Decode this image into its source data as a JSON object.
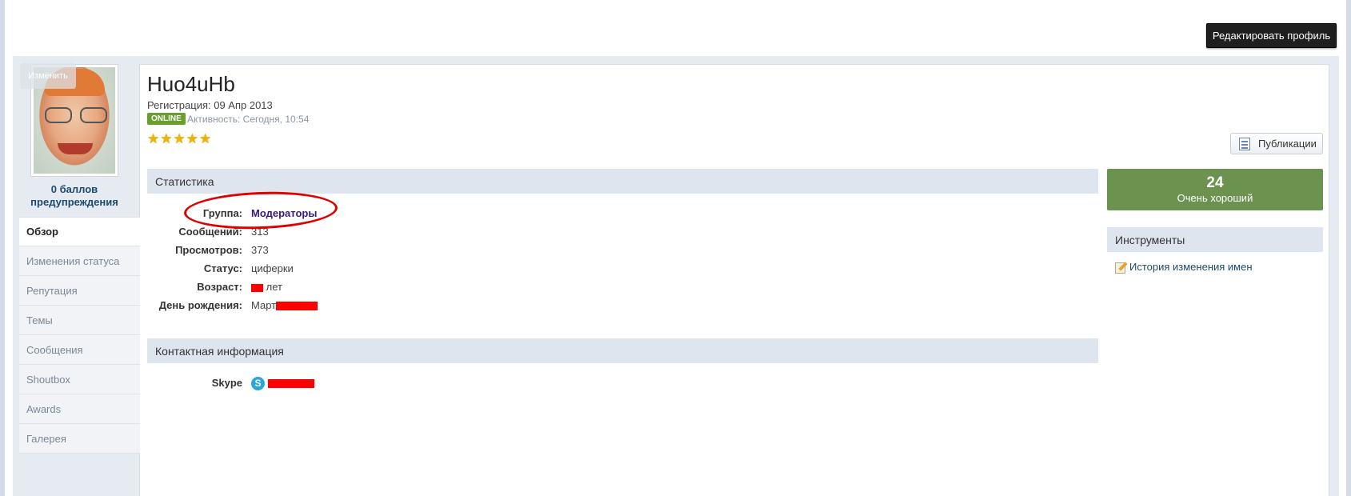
{
  "header": {
    "edit_profile_label": "Редактировать профиль"
  },
  "sidebar": {
    "change_avatar_label": "Изменить",
    "warn_points": "0 баллов предупреждения",
    "items": [
      {
        "label": "Обзор",
        "active": true
      },
      {
        "label": "Изменения статуса"
      },
      {
        "label": "Репутация"
      },
      {
        "label": "Темы"
      },
      {
        "label": "Сообщения"
      },
      {
        "label": "Shoutbox"
      },
      {
        "label": "Awards"
      },
      {
        "label": "Галерея"
      }
    ]
  },
  "profile": {
    "username": "Huo4uHb",
    "registration": "Регистрация: 09 Апр 2013",
    "online_badge": "ONLINE",
    "activity": "Активность: Сегодня, 10:54",
    "rating_stars": 5,
    "publications_label": "Публикации"
  },
  "stats": {
    "title": "Статистика",
    "fields": [
      {
        "label": "Группа:",
        "value": "Модераторы"
      },
      {
        "label": "Сообщений:",
        "value": "313"
      },
      {
        "label": "Просмотров:",
        "value": "373"
      },
      {
        "label": "Статус:",
        "value": "циферки"
      },
      {
        "label": "Возраст:",
        "value": "лет"
      },
      {
        "label": "День рождения:",
        "value": "Март"
      }
    ]
  },
  "contact": {
    "title": "Контактная информация",
    "skype_label": "Skype"
  },
  "reputation": {
    "value": "24",
    "text": "Очень хороший",
    "color": "#6b934f"
  },
  "tools": {
    "title": "Инструменты",
    "name_history_label": "История изменения имен"
  }
}
